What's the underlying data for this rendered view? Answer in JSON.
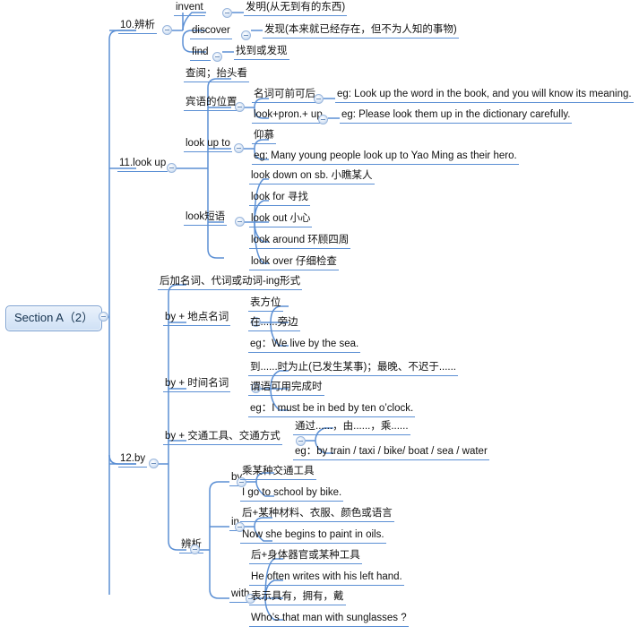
{
  "title": "Section A（2）思维导图",
  "colors": {
    "line": "#5b8fd4",
    "node_text": "#111111",
    "root_fill": "#dbe8f8",
    "root_border": "#7a9fd0",
    "toggle_border": "#9ab6dc"
  },
  "root": {
    "label": "Section A（2）"
  },
  "nodes": {
    "n10": {
      "label": "10.辨析"
    },
    "invent": {
      "label": "invent"
    },
    "invent_def": {
      "label": "发明(从无到有的东西)"
    },
    "discover": {
      "label": "discover"
    },
    "discover_def": {
      "label": "发现(本来就已经存在，但不为人知的事物)"
    },
    "find": {
      "label": "find"
    },
    "find_def": {
      "label": "找到或发现"
    },
    "n11": {
      "label": "11.look up"
    },
    "lookup_meaning": {
      "label": "查阅；抬头看"
    },
    "obj_pos": {
      "label": "宾语的位置"
    },
    "noun_pos": {
      "label": "名词可前可后"
    },
    "noun_pos_eg": {
      "label": "eg: Look up the word in the book, and you will know its meaning."
    },
    "pron_pos": {
      "label": "look+pron.+ up"
    },
    "pron_pos_eg": {
      "label": "eg: Please look them up in the dictionary carefully."
    },
    "look_up_to": {
      "label": "look up to"
    },
    "look_up_to_def": {
      "label": "仰慕"
    },
    "look_up_to_eg": {
      "label": "eg: Many young people look up to Yao Ming as their hero."
    },
    "look_phrases": {
      "label": "look短语"
    },
    "look_down_on": {
      "label": "look down on sb. 小瞧某人"
    },
    "look_for": {
      "label": "look for 寻找"
    },
    "look_out": {
      "label": "look out 小心"
    },
    "look_around": {
      "label": "look around 环顾四周"
    },
    "look_over": {
      "label": "look over 仔细检查"
    },
    "n12": {
      "label": "12.by"
    },
    "by_rule": {
      "label": "后加名词、代词或动词-ing形式"
    },
    "by_place": {
      "label": "by + 地点名词"
    },
    "by_place_def": {
      "label": "表方位"
    },
    "by_place_def2": {
      "label": "在......旁边"
    },
    "by_place_eg": {
      "label": "eg：We live by the sea."
    },
    "by_time": {
      "label": "by + 时间名词"
    },
    "by_time_def": {
      "label": "到......时为止(已发生某事)；最晚、不迟于......"
    },
    "by_time_def2": {
      "label": "谓语可用完成时"
    },
    "by_time_eg": {
      "label": "eg：I must be in bed by ten o’clock."
    },
    "by_transport": {
      "label": "by + 交通工具、交通方式"
    },
    "by_transport_def": {
      "label": "通过......，由......，乘......"
    },
    "by_transport_eg": {
      "label": "eg：by train / taxi / bike/ boat / sea / water"
    },
    "distinguish": {
      "label": "辨析"
    },
    "by_word": {
      "label": "by"
    },
    "by_word_def": {
      "label": "乘某种交通工具"
    },
    "by_word_eg": {
      "label": "I go to school by bike."
    },
    "in_word": {
      "label": "in"
    },
    "in_word_def": {
      "label": "后+某种材料、衣服、颜色或语言"
    },
    "in_word_eg": {
      "label": "Now she begins to paint in oils."
    },
    "with_word": {
      "label": "with"
    },
    "with_word_def": {
      "label": "后+身体器官或某种工具"
    },
    "with_word_eg": {
      "label": "He often writes with his left hand."
    },
    "with_word_def2": {
      "label": "表示具有，拥有，戴"
    },
    "with_word_eg2": {
      "label": "Who’s that man with sunglasses ?"
    }
  }
}
